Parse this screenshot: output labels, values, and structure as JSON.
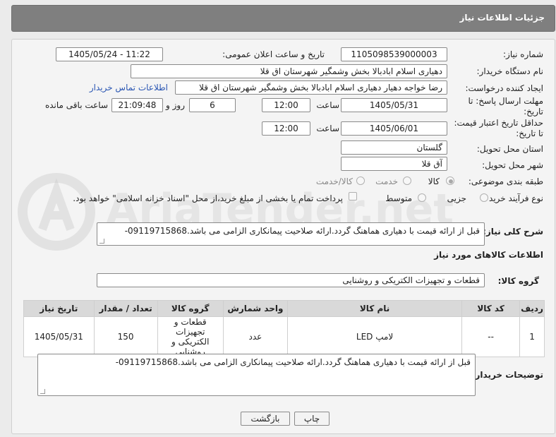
{
  "header": {
    "title": "جزئیات اطلاعات نیاز"
  },
  "fields": {
    "need_number": {
      "label": "شماره نیاز:",
      "value": "1105098539000003"
    },
    "announce_datetime": {
      "label": "تاریخ و ساعت اعلان عمومی:",
      "value": "1405/05/24 - 11:22"
    },
    "buyer_org": {
      "label": "نام دستگاه خریدار:",
      "value": "دهیاری اسلام ابادبالا بخش وشمگیر شهرستان اق قلا"
    },
    "requester": {
      "label": "ایجاد کننده درخواست:",
      "value": "رضا خواجه دهیار دهیاری اسلام ابادبالا بخش وشمگیر شهرستان اق قلا",
      "contact_link": "اطلاعات تماس خریدار"
    },
    "reply_deadline": {
      "label": "مهلت ارسال پاسخ: تا تاریخ:",
      "date": "1405/05/31",
      "time_label": "ساعت",
      "time": "12:00",
      "days": "6",
      "days_label": "روز و",
      "remaining": "21:09:48",
      "remaining_label": "ساعت باقی مانده"
    },
    "price_validity": {
      "label": "حداقل تاریخ اعتبار قیمت: تا تاریخ:",
      "date": "1405/06/01",
      "time_label": "ساعت",
      "time": "12:00"
    },
    "province": {
      "label": "استان محل تحویل:",
      "value": "گلستان"
    },
    "city": {
      "label": "شهر محل تحویل:",
      "value": "آق قلا"
    },
    "category": {
      "label": "طبقه بندی موضوعی:",
      "options": [
        "کالا",
        "خدمت",
        "کالا/خدمت"
      ]
    },
    "process_type": {
      "label": "نوع فرآیند خرید :",
      "options": [
        "جزیی",
        "متوسط"
      ],
      "payment_note": "پرداخت تمام یا بخشی از مبلغ خرید،از محل \"اسناد خزانه اسلامی\" خواهد بود."
    }
  },
  "description": {
    "label": "شرح کلی نیاز:",
    "value": "قبل از ارائه قیمت با دهیاری هماهنگ گردد.ارائه صلاحیت پیمانکاری الزامی می باشد.09119715868-"
  },
  "goods_info": {
    "title": "اطلاعات کالاهای مورد نیاز",
    "group_label": "گروه کالا:",
    "group_value": "قطعات و تجهیزات الکتریکی و روشنایی"
  },
  "table": {
    "headers": [
      "ردیف",
      "کد کالا",
      "نام کالا",
      "واحد شمارش",
      "گروه کالا",
      "تعداد / مقدار",
      "تاریخ نیاز"
    ],
    "rows": [
      [
        "1",
        "--",
        "لامپ LED",
        "عدد",
        "قطعات و تجهیزات الکتریکی و روشنایی",
        "150",
        "1405/05/31"
      ]
    ]
  },
  "buyer_notes": {
    "label": "توضیحات خریدار:",
    "value": "قبل از ارائه قیمت با دهیاری هماهنگ گردد.ارائه صلاحیت پیمانکاری الزامی می باشد.09119715868-"
  },
  "buttons": {
    "print": "چاپ",
    "back": "بازگشت"
  },
  "watermark": "AriaTender.net"
}
